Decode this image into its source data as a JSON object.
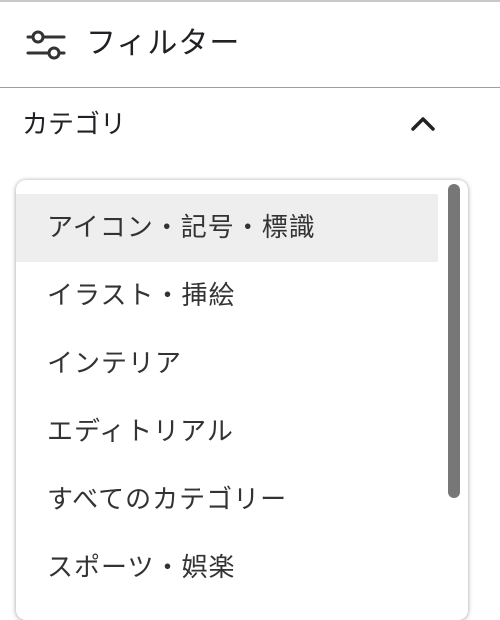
{
  "header": {
    "title": "フィルター",
    "icon": "sliders-icon"
  },
  "category": {
    "label": "カテゴリ",
    "expanded": true,
    "chevron_icon": "chevron-up-icon"
  },
  "dropdown": {
    "options": [
      {
        "label": "アイコン・記号・標識",
        "highlighted": true
      },
      {
        "label": "イラスト・挿絵"
      },
      {
        "label": "インテリア"
      },
      {
        "label": "エディトリアル"
      },
      {
        "label": "すべてのカテゴリー"
      },
      {
        "label": "スポーツ・娯楽"
      }
    ],
    "highlight_color": "#eeeeee",
    "scrollbar_color": "#777777"
  }
}
